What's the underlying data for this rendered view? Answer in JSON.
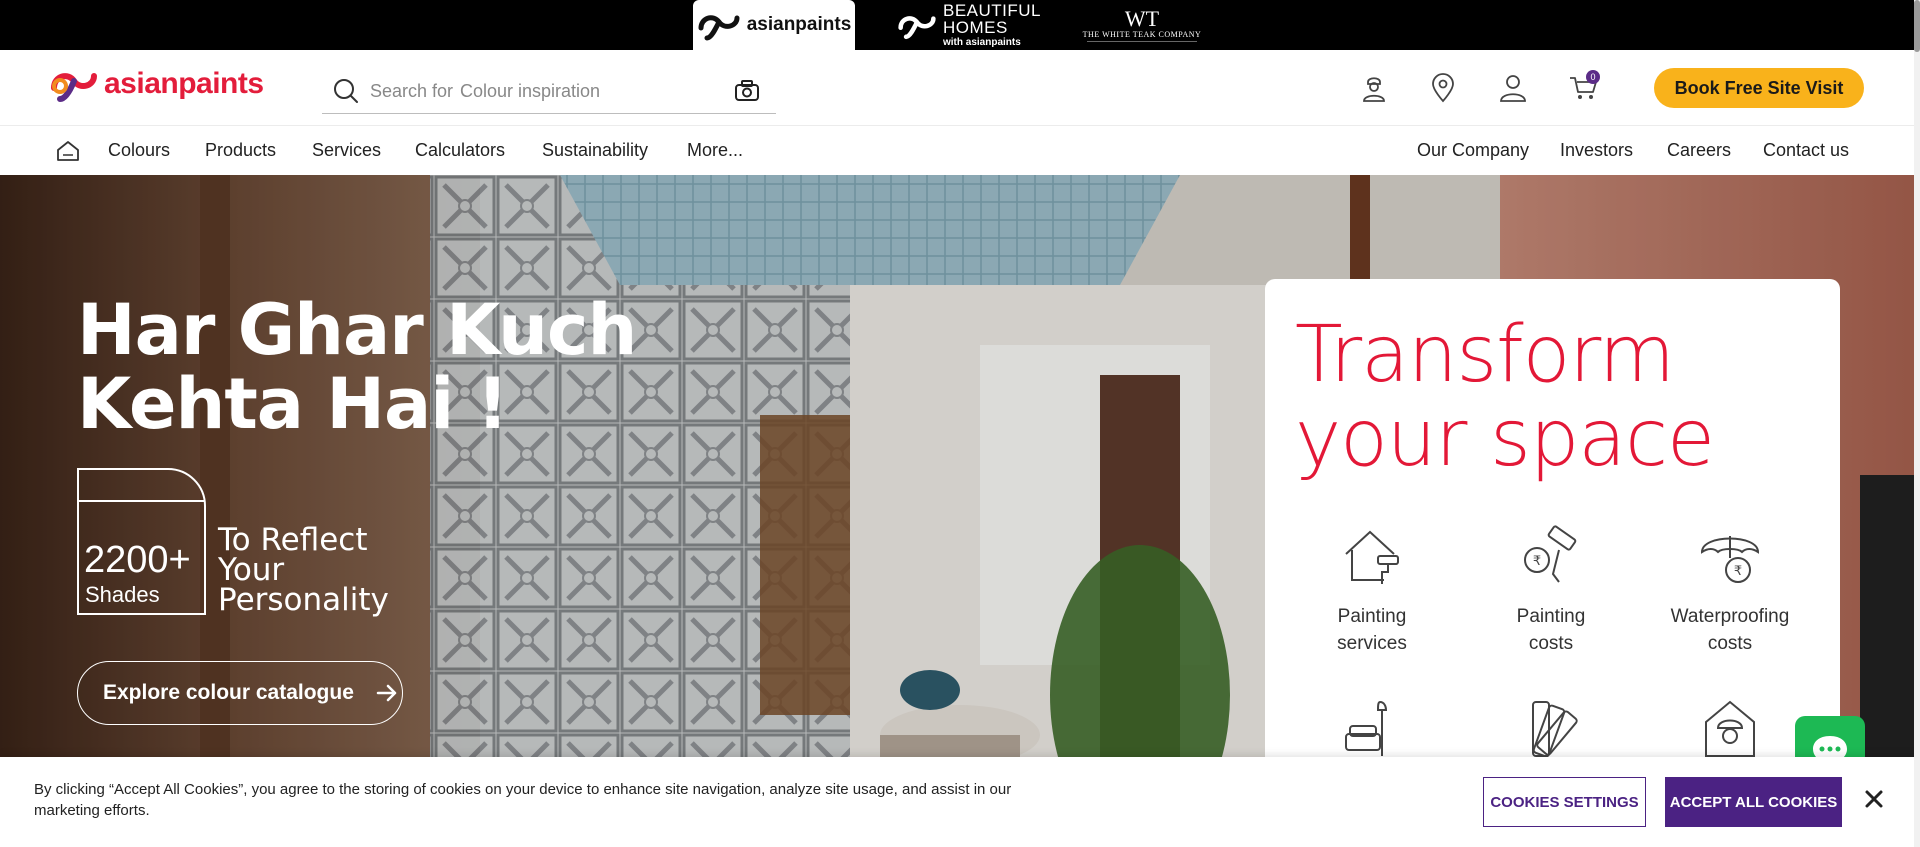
{
  "brand_strip": {
    "tabs": [
      {
        "label": "asianpaints",
        "active": true
      },
      {
        "label_line1": "BEAUTIFUL",
        "label_line2": "HOMES",
        "label_line3": "with asianpaints"
      },
      {
        "monogram": "WT",
        "label": "THE WHITE TEAK COMPANY"
      }
    ]
  },
  "header": {
    "logo_text": "asianpaints",
    "search": {
      "prefix": "Search for",
      "placeholder": "Colour inspiration"
    },
    "cart_count": "0",
    "book_button": "Book Free Site Visit",
    "icons": [
      "painter-icon",
      "location-pin-icon",
      "user-icon",
      "cart-icon"
    ]
  },
  "nav": {
    "left_items": [
      "Colours",
      "Products",
      "Services",
      "Calculators",
      "Sustainability",
      "More..."
    ],
    "right_items": [
      "Our Company",
      "Investors",
      "Careers",
      "Contact us"
    ]
  },
  "hero": {
    "title_line1": "Har Ghar Kuch",
    "title_line2": "Kehta Hai !",
    "shades_count": "2200+",
    "shades_label": "Shades",
    "tagline_line1": "To Reflect",
    "tagline_line2": "Your",
    "tagline_line3": "Personality",
    "cta": "Explore colour catalogue"
  },
  "card": {
    "title_line1": "Transform",
    "title_line2": "your space",
    "services": [
      {
        "line1": "Painting",
        "line2": "services",
        "icon": "house-roller-icon"
      },
      {
        "line1": "Painting",
        "line2": "costs",
        "icon": "rupee-roller-icon"
      },
      {
        "line1": "Waterproofing",
        "line2": "costs",
        "icon": "umbrella-rupee-icon"
      }
    ],
    "second_row_icons": [
      "sofa-lamp-icon",
      "colour-swatch-icon",
      "worker-helmet-icon"
    ]
  },
  "cookie": {
    "text": "By clicking “Accept All Cookies”, you agree to the storing of cookies on your device to enhance site navigation, analyze site usage, and assist in our marketing efforts.",
    "settings_button": "COOKIES SETTINGS",
    "accept_button": "ACCEPT ALL COOKIES"
  },
  "colors": {
    "brand_red": "#e31837",
    "accent_yellow": "#f9b21b",
    "cookie_purple": "#4b2283",
    "chat_green": "#1db954"
  }
}
